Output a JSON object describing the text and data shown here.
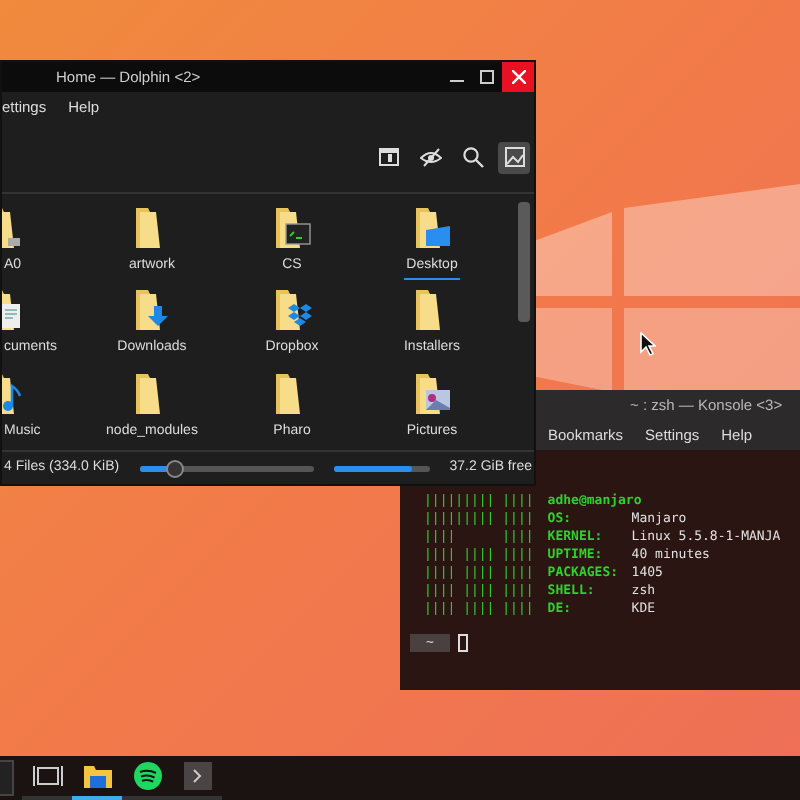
{
  "dolphin": {
    "title": "Home — Dolphin <2>",
    "menu": [
      "ettings",
      "Help"
    ],
    "toolbar": [
      {
        "kind": "panel",
        "selected": false
      },
      {
        "kind": "hidden",
        "selected": false
      },
      {
        "kind": "search",
        "selected": false
      },
      {
        "kind": "preview",
        "selected": true
      }
    ],
    "files": [
      {
        "name": "A0",
        "kind": "emblem",
        "selected": false
      },
      {
        "name": "artwork",
        "kind": "plain",
        "selected": false
      },
      {
        "name": "CS",
        "kind": "terminal",
        "selected": false
      },
      {
        "name": "Desktop",
        "kind": "desktop",
        "selected": true
      },
      {
        "name": "cuments",
        "kind": "documents",
        "selected": false
      },
      {
        "name": "Downloads",
        "kind": "downloads",
        "selected": false
      },
      {
        "name": "Dropbox",
        "kind": "dropbox",
        "selected": false
      },
      {
        "name": "Installers",
        "kind": "plain",
        "selected": false
      },
      {
        "name": "Music",
        "kind": "music",
        "selected": false
      },
      {
        "name": "node_modules",
        "kind": "plain",
        "selected": false
      },
      {
        "name": "Pharo",
        "kind": "plain",
        "selected": false
      },
      {
        "name": "Pictures",
        "kind": "pictures",
        "selected": false
      }
    ],
    "status": "4 Files (334.0 KiB)",
    "zoom": {
      "level": 0.2
    },
    "disk": {
      "level": 0.82,
      "reading": "37.2 GiB free"
    }
  },
  "konsole": {
    "title": "~ : zsh — Konsole <3>",
    "menu": [
      "Bookmarks",
      "Settings",
      "Help"
    ],
    "art": [
      "||||||||| ||||",
      "||||||||| ||||",
      "||||      ||||",
      "|||| |||| ||||",
      "|||| |||| ||||",
      "|||| |||| ||||",
      "|||| |||| ||||"
    ],
    "user": "adhe@manjaro",
    "info": [
      {
        "label": "OS:",
        "value": "Manjaro"
      },
      {
        "label": "KERNEL:",
        "value": "Linux 5.5.8-1-MANJA"
      },
      {
        "label": "UPTIME:",
        "value": "40 minutes"
      },
      {
        "label": "PACKAGES:",
        "value": "1405"
      },
      {
        "label": "SHELL:",
        "value": "zsh"
      },
      {
        "label": "DE:",
        "value": "KDE"
      }
    ],
    "prompt": "~"
  },
  "taskbar": {
    "items": [
      {
        "kind": "pager",
        "selected": false
      },
      {
        "kind": "files",
        "selected": true
      },
      {
        "kind": "spotify",
        "selected": false
      },
      {
        "kind": "terminal",
        "selected": false
      }
    ]
  }
}
